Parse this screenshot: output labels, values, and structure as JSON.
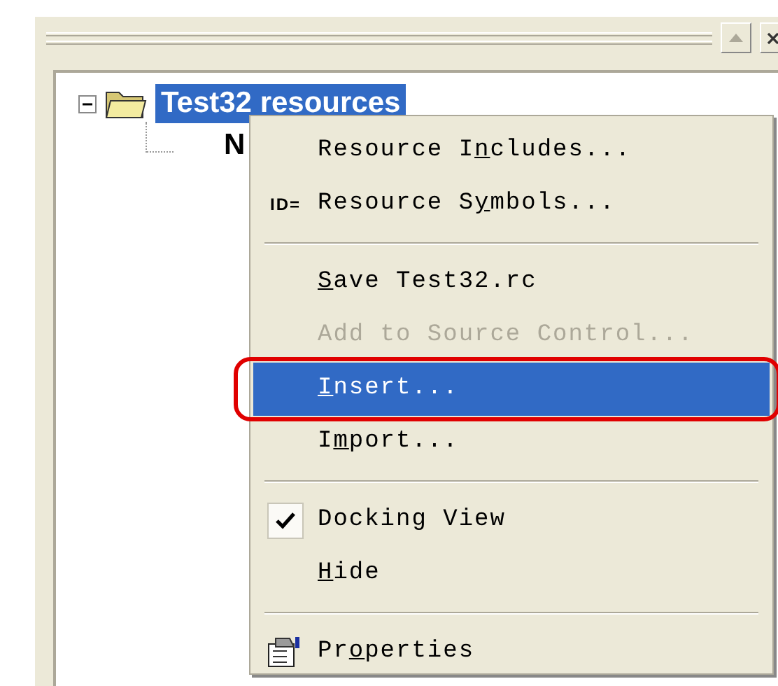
{
  "panel": {
    "tree": {
      "label": "Test32 resources",
      "selected": true,
      "expanded": true,
      "children": [
        {
          "label": "N"
        }
      ]
    }
  },
  "context_menu": {
    "items": [
      {
        "kind": "item",
        "before": "Resource I",
        "access_key": "n",
        "after": "cludes...",
        "disabled": false,
        "selected": false,
        "circled": false
      },
      {
        "kind": "item",
        "icon_text": "ID=",
        "before": "Resource S",
        "access_key": "y",
        "after": "mbols...",
        "disabled": false,
        "selected": false,
        "circled": false
      },
      {
        "kind": "separator"
      },
      {
        "kind": "item",
        "access_key": "S",
        "after": "ave Test32.rc",
        "disabled": false,
        "selected": false,
        "circled": false
      },
      {
        "kind": "item",
        "before": "Add to Source Control...",
        "disabled": true,
        "selected": false,
        "circled": false
      },
      {
        "kind": "item",
        "access_key": "I",
        "after": "nsert...",
        "disabled": false,
        "selected": true,
        "circled": true
      },
      {
        "kind": "item",
        "before": "I",
        "access_key": "m",
        "after": "port...",
        "disabled": false,
        "selected": false,
        "circled": false
      },
      {
        "kind": "separator"
      },
      {
        "kind": "check",
        "before": "Docking View",
        "checked": true,
        "disabled": false,
        "selected": false,
        "circled": false
      },
      {
        "kind": "item",
        "access_key": "H",
        "after": "ide",
        "disabled": false,
        "selected": false,
        "circled": false
      },
      {
        "kind": "separator"
      },
      {
        "kind": "properties",
        "before": "Pr",
        "access_key": "o",
        "after": "perties",
        "disabled": false,
        "selected": false,
        "circled": false
      }
    ]
  }
}
